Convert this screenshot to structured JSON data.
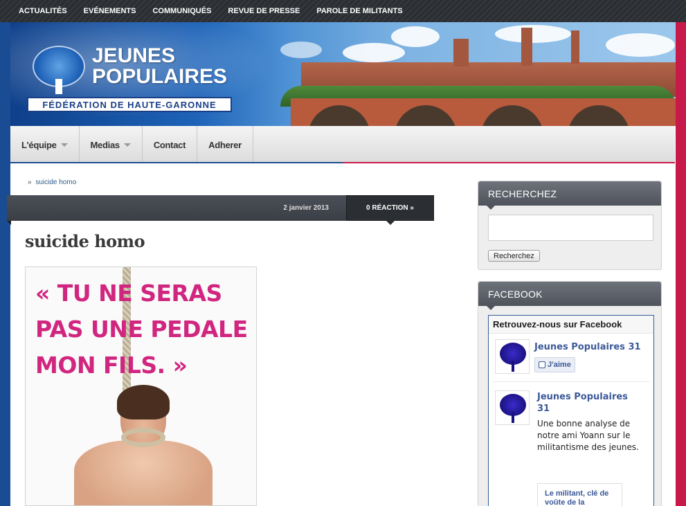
{
  "topnav": {
    "items": [
      "ACTUALITÉS",
      "EVÉNEMENTS",
      "COMMUNIQUÉS",
      "REVUE DE PRESSE",
      "PAROLE DE MILITANTS"
    ]
  },
  "banner": {
    "title_line1": "JEUNES",
    "title_line2": "POPULAIRES",
    "federation": "FÉDÉRATION DE HAUTE-GARONNE"
  },
  "mainnav": {
    "items": [
      {
        "label": "L'équipe",
        "dropdown": true
      },
      {
        "label": "Medias",
        "dropdown": true
      },
      {
        "label": "Contact",
        "dropdown": false
      },
      {
        "label": "Adherer",
        "dropdown": false
      }
    ]
  },
  "breadcrumb": {
    "separator": "»",
    "current": "suicide homo"
  },
  "post": {
    "date": "2 janvier 2013",
    "reactions": "0 RÉACTION »",
    "title": "suicide homo",
    "poster_line1": "« TU NE SERAS",
    "poster_line2": "PAS UNE PEDALE",
    "poster_line3": "MON FILS. »"
  },
  "sidebar": {
    "search": {
      "heading": "RECHERCHEZ",
      "input_value": "",
      "button_label": "Recherchez"
    },
    "facebook": {
      "heading": "FACEBOOK",
      "box_title": "Retrouvez-nous sur Facebook",
      "page_name": "Jeunes Populaires 31",
      "like_label": "J'aime",
      "post_author_line1": "Jeunes Populaires",
      "post_author_line2": "31",
      "post_text": "Une bonne analyse de notre ami Yoann sur le militantisme des jeunes.",
      "link_title": "Le militant, clé de voûte de la"
    }
  },
  "colors": {
    "blue": "#1a4c93",
    "red": "#c8194b",
    "poster_pink": "#d1267f",
    "facebook_blue": "#3b5998"
  }
}
